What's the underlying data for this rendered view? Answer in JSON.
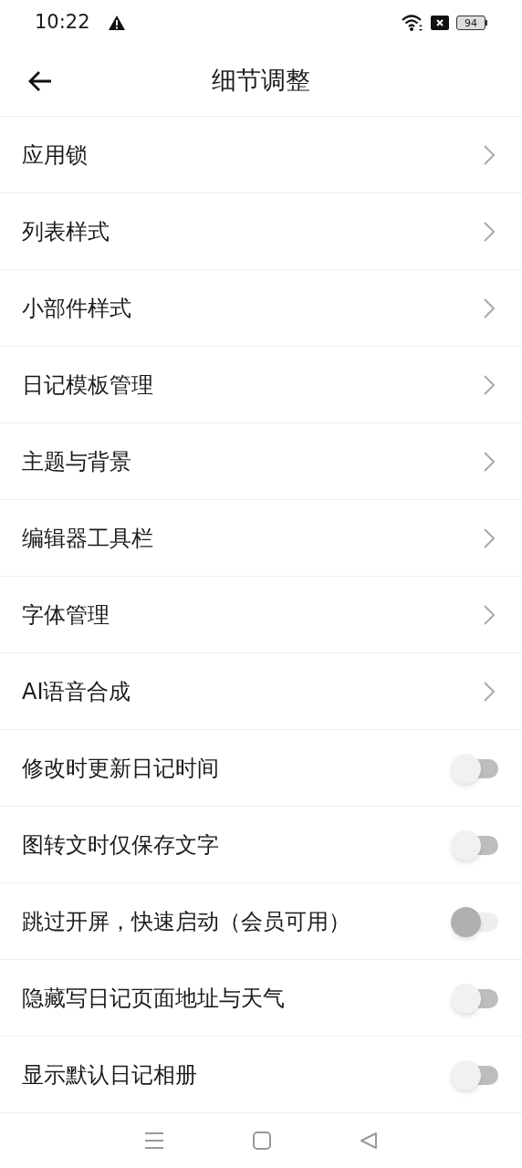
{
  "status_bar": {
    "time": "10:22",
    "battery": "94"
  },
  "header": {
    "title": "细节调整"
  },
  "items": [
    {
      "kind": "link",
      "label": "应用锁"
    },
    {
      "kind": "link",
      "label": "列表样式"
    },
    {
      "kind": "link",
      "label": "小部件样式"
    },
    {
      "kind": "link",
      "label": "日记模板管理"
    },
    {
      "kind": "link",
      "label": "主题与背景"
    },
    {
      "kind": "link",
      "label": "编辑器工具栏"
    },
    {
      "kind": "link",
      "label": "字体管理"
    },
    {
      "kind": "link",
      "label": "AI语音合成"
    },
    {
      "kind": "toggle",
      "label": "修改时更新日记时间",
      "on": false,
      "disabled": false
    },
    {
      "kind": "toggle",
      "label": "图转文时仅保存文字",
      "on": false,
      "disabled": false
    },
    {
      "kind": "toggle",
      "label": "跳过开屏，快速启动（会员可用）",
      "on": false,
      "disabled": true
    },
    {
      "kind": "toggle",
      "label": "隐藏写日记页面地址与天气",
      "on": false,
      "disabled": false
    },
    {
      "kind": "toggle",
      "label": "显示默认日记相册",
      "on": false,
      "disabled": false
    }
  ]
}
